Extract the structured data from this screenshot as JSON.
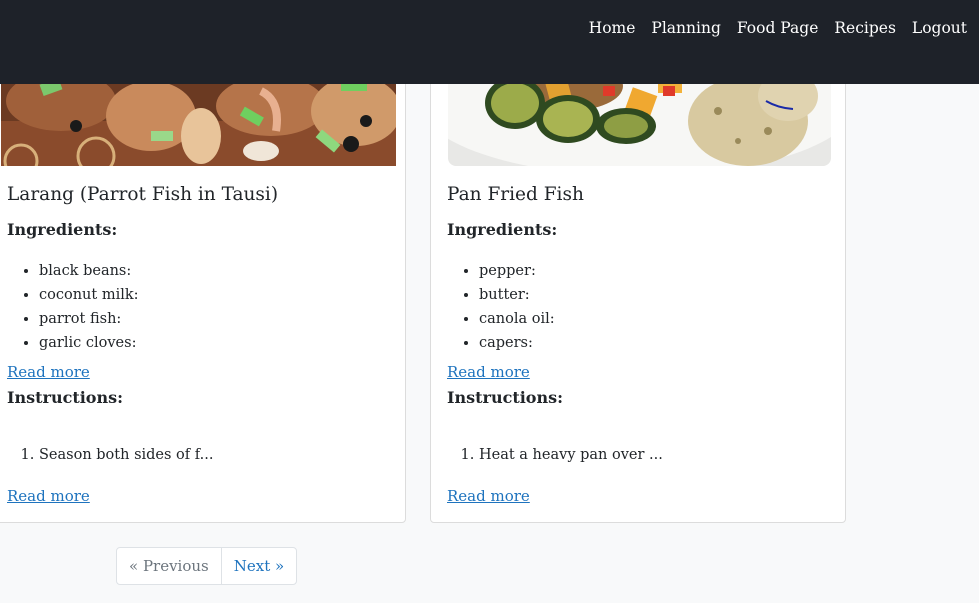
{
  "nav": {
    "links": [
      "Home",
      "Planning",
      "Food Page",
      "Recipes",
      "Logout"
    ]
  },
  "recipes": [
    {
      "title": "Larang (Parrot Fish in Tausi)",
      "ingredients_label": "Ingredients:",
      "ingredients": [
        "black beans:",
        "coconut milk:",
        "parrot fish:",
        "garlic cloves:"
      ],
      "read_more_1": "Read more",
      "instructions_label": "Instructions:",
      "instructions": [
        "Season both sides of f..."
      ],
      "read_more_2": "Read more"
    },
    {
      "title": "Pan Fried Fish",
      "ingredients_label": "Ingredients:",
      "ingredients": [
        "pepper:",
        "butter:",
        "canola oil:",
        "capers:"
      ],
      "read_more_1": "Read more",
      "instructions_label": "Instructions:",
      "instructions": [
        "Heat a heavy pan over ..."
      ],
      "read_more_2": "Read more"
    }
  ],
  "pagination": {
    "previous": "« Previous",
    "next": "Next »"
  },
  "colors": {
    "navbar": "#1e2229",
    "link": "#1e73be",
    "page_bg": "#f8f9fa"
  }
}
